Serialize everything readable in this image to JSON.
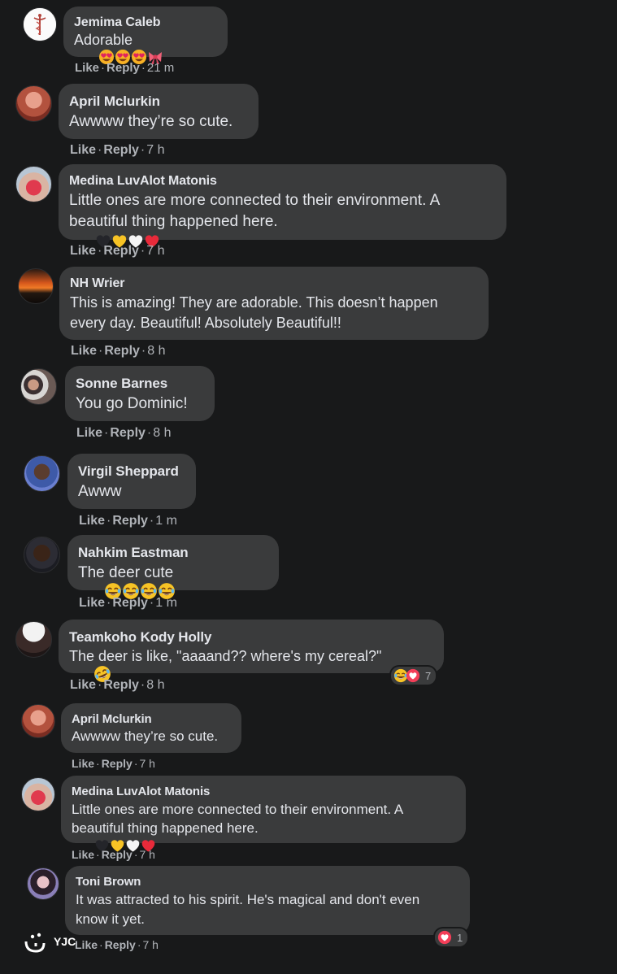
{
  "comments": [
    {
      "author": "Jemima Caleb",
      "text": "Adorable",
      "like": "Like",
      "reply": "Reply",
      "time": "21 m"
    },
    {
      "author": "April Mclurkin",
      "text": "Awwww they’re so cute.",
      "like": "Like",
      "reply": "Reply",
      "time": "7 h"
    },
    {
      "author": "Medina LuvAlot Matonis",
      "text": "Little ones are more connected to their environment. A\nbeautiful thing happened here.",
      "like": "Like",
      "reply": "Reply",
      "time": "7 h"
    },
    {
      "author": "NH Wrier",
      "text": "This is amazing! They are adorable. This doesn’t happen\nevery day. Beautiful! Absolutely Beautiful!!",
      "like": "Like",
      "reply": "Reply",
      "time": "8 h"
    },
    {
      "author": "Sonne Barnes",
      "text": "You go Dominic!",
      "like": "Like",
      "reply": "Reply",
      "time": "8 h"
    },
    {
      "author": "Virgil Sheppard",
      "text": "Awww",
      "like": "Like",
      "reply": "Reply",
      "time": "1 m"
    },
    {
      "author": "Nahkim Eastman",
      "text": "The deer cute",
      "like": "Like",
      "reply": "Reply",
      "time": "1 m"
    },
    {
      "author": "Teamkoho Kody Holly",
      "text": "The deer is like, \"aaaand?? where's my cereal?\"",
      "like": "Like",
      "reply": "Reply",
      "time": "8 h",
      "reaction_count": "7"
    },
    {
      "author": "April Mclurkin",
      "text": "Awwww they’re so cute.",
      "like": "Like",
      "reply": "Reply",
      "time": "7 h"
    },
    {
      "author": "Medina LuvAlot Matonis",
      "text": "Little ones are more connected to their environment. A\nbeautiful thing happened here.",
      "like": "Like",
      "reply": "Reply",
      "time": "7 h"
    },
    {
      "author": "Toni Brown",
      "text": "It was attracted to his spirit. He's magical and don't even\nknow it yet.",
      "like": "Like",
      "reply": "Reply",
      "time": "7 h",
      "reaction_count": "1"
    }
  ],
  "watermark": {
    "text": "YJC"
  },
  "icons": {
    "heart_eyes": "heart-eyes-emoji",
    "bow": "bow-emoji",
    "joy": "tears-of-joy-emoji",
    "rofl": "rolling-laughing-emoji",
    "hearts": [
      "black-heart",
      "yellow-heart",
      "white-heart",
      "red-heart"
    ]
  },
  "colors": {
    "background": "#18191a",
    "bubble": "#3a3b3c",
    "text": "#e4e6eb",
    "secondary_text": "#b0b3b8",
    "love_reaction": "#f33e58",
    "haha_reaction": "#f7b125"
  }
}
